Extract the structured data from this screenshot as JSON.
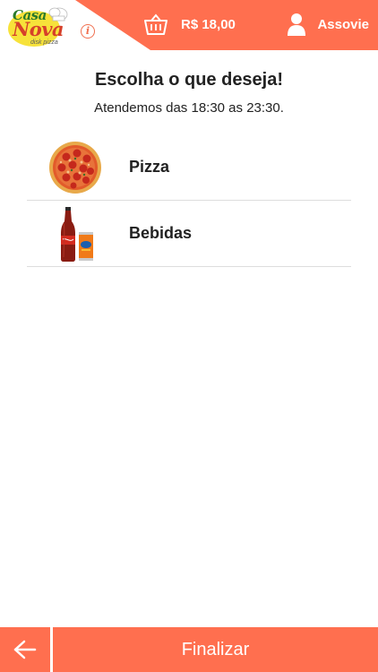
{
  "colors": {
    "accent": "#ff6f4f",
    "text": "#222222",
    "divider": "#dddddd"
  },
  "header": {
    "logo": {
      "line1": "Casa",
      "line2": "Nova",
      "tagline": "disk pizza"
    },
    "info_icon": "info-icon",
    "cart": {
      "icon": "basket-icon",
      "total": "R$ 18,00"
    },
    "account": {
      "icon": "user-icon",
      "label": "Assovie"
    }
  },
  "main": {
    "title": "Escolha o que deseja!",
    "hours": "Atendemos das 18:30 as 23:30.",
    "categories": [
      {
        "label": "Pizza",
        "thumb": "pizza-image"
      },
      {
        "label": "Bebidas",
        "thumb": "drinks-image"
      }
    ]
  },
  "footer": {
    "back_icon": "arrow-left-icon",
    "finish_label": "Finalizar"
  }
}
